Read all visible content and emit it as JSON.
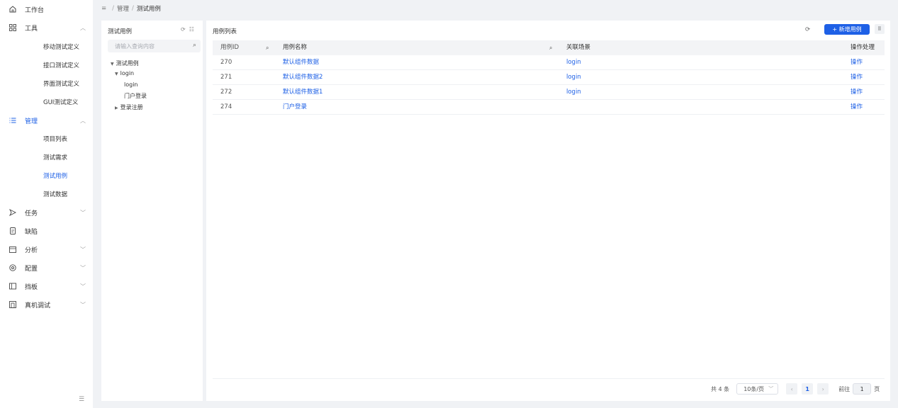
{
  "sidebar": {
    "workbench": "工作台",
    "tools": {
      "label": "工具",
      "items": [
        "移动测试定义",
        "接口测试定义",
        "界面测试定义",
        "GUI测试定义"
      ]
    },
    "manage": {
      "label": "管理",
      "items": [
        "项目列表",
        "测试需求",
        "测试用例",
        "测试数据"
      ],
      "active_item": "测试用例"
    },
    "task": "任务",
    "defect": "缺陷",
    "analysis": "分析",
    "config": "配置",
    "board": "挡板",
    "device": "真机调试",
    "arrow_up": "︿",
    "arrow_down": "﹀",
    "collapse": "☰"
  },
  "breadcrumb": {
    "items": [
      "管理",
      "测试用例"
    ],
    "separator": "/"
  },
  "tree": {
    "title": "测试用例",
    "search_placeholder": "请输入查询内容",
    "nodes": {
      "root": "测试用例",
      "login_folder": "login",
      "login_case": "login",
      "portal_login": "门户登录",
      "register": "登录注册"
    }
  },
  "main": {
    "title": "用例列表",
    "refresh": "⟳",
    "add_button": "+ 新增用例",
    "grid": "⠿",
    "table": {
      "headers": {
        "id": "用例ID",
        "name": "用例名称",
        "scene": "关联场景",
        "op": "操作处理"
      },
      "rows": [
        {
          "id": "270",
          "name": "默认组件数据",
          "scene": "login",
          "op": "操作"
        },
        {
          "id": "271",
          "name": "默认组件数据2",
          "scene": "login",
          "op": "操作"
        },
        {
          "id": "272",
          "name": "默认组件数据1",
          "scene": "login",
          "op": "操作"
        },
        {
          "id": "274",
          "name": "门户登录",
          "scene": "",
          "op": "操作"
        }
      ]
    },
    "pagination": {
      "total": "共 4 条",
      "page_size": "10条/页",
      "prev": "‹",
      "current": "1",
      "next": "›",
      "goto_label": "前往",
      "goto_value": "1",
      "page_unit": "页"
    }
  },
  "colors": {
    "accent": "#1e60e6",
    "background": "#f0f2f5",
    "header_bg": "#f3f4f6"
  }
}
